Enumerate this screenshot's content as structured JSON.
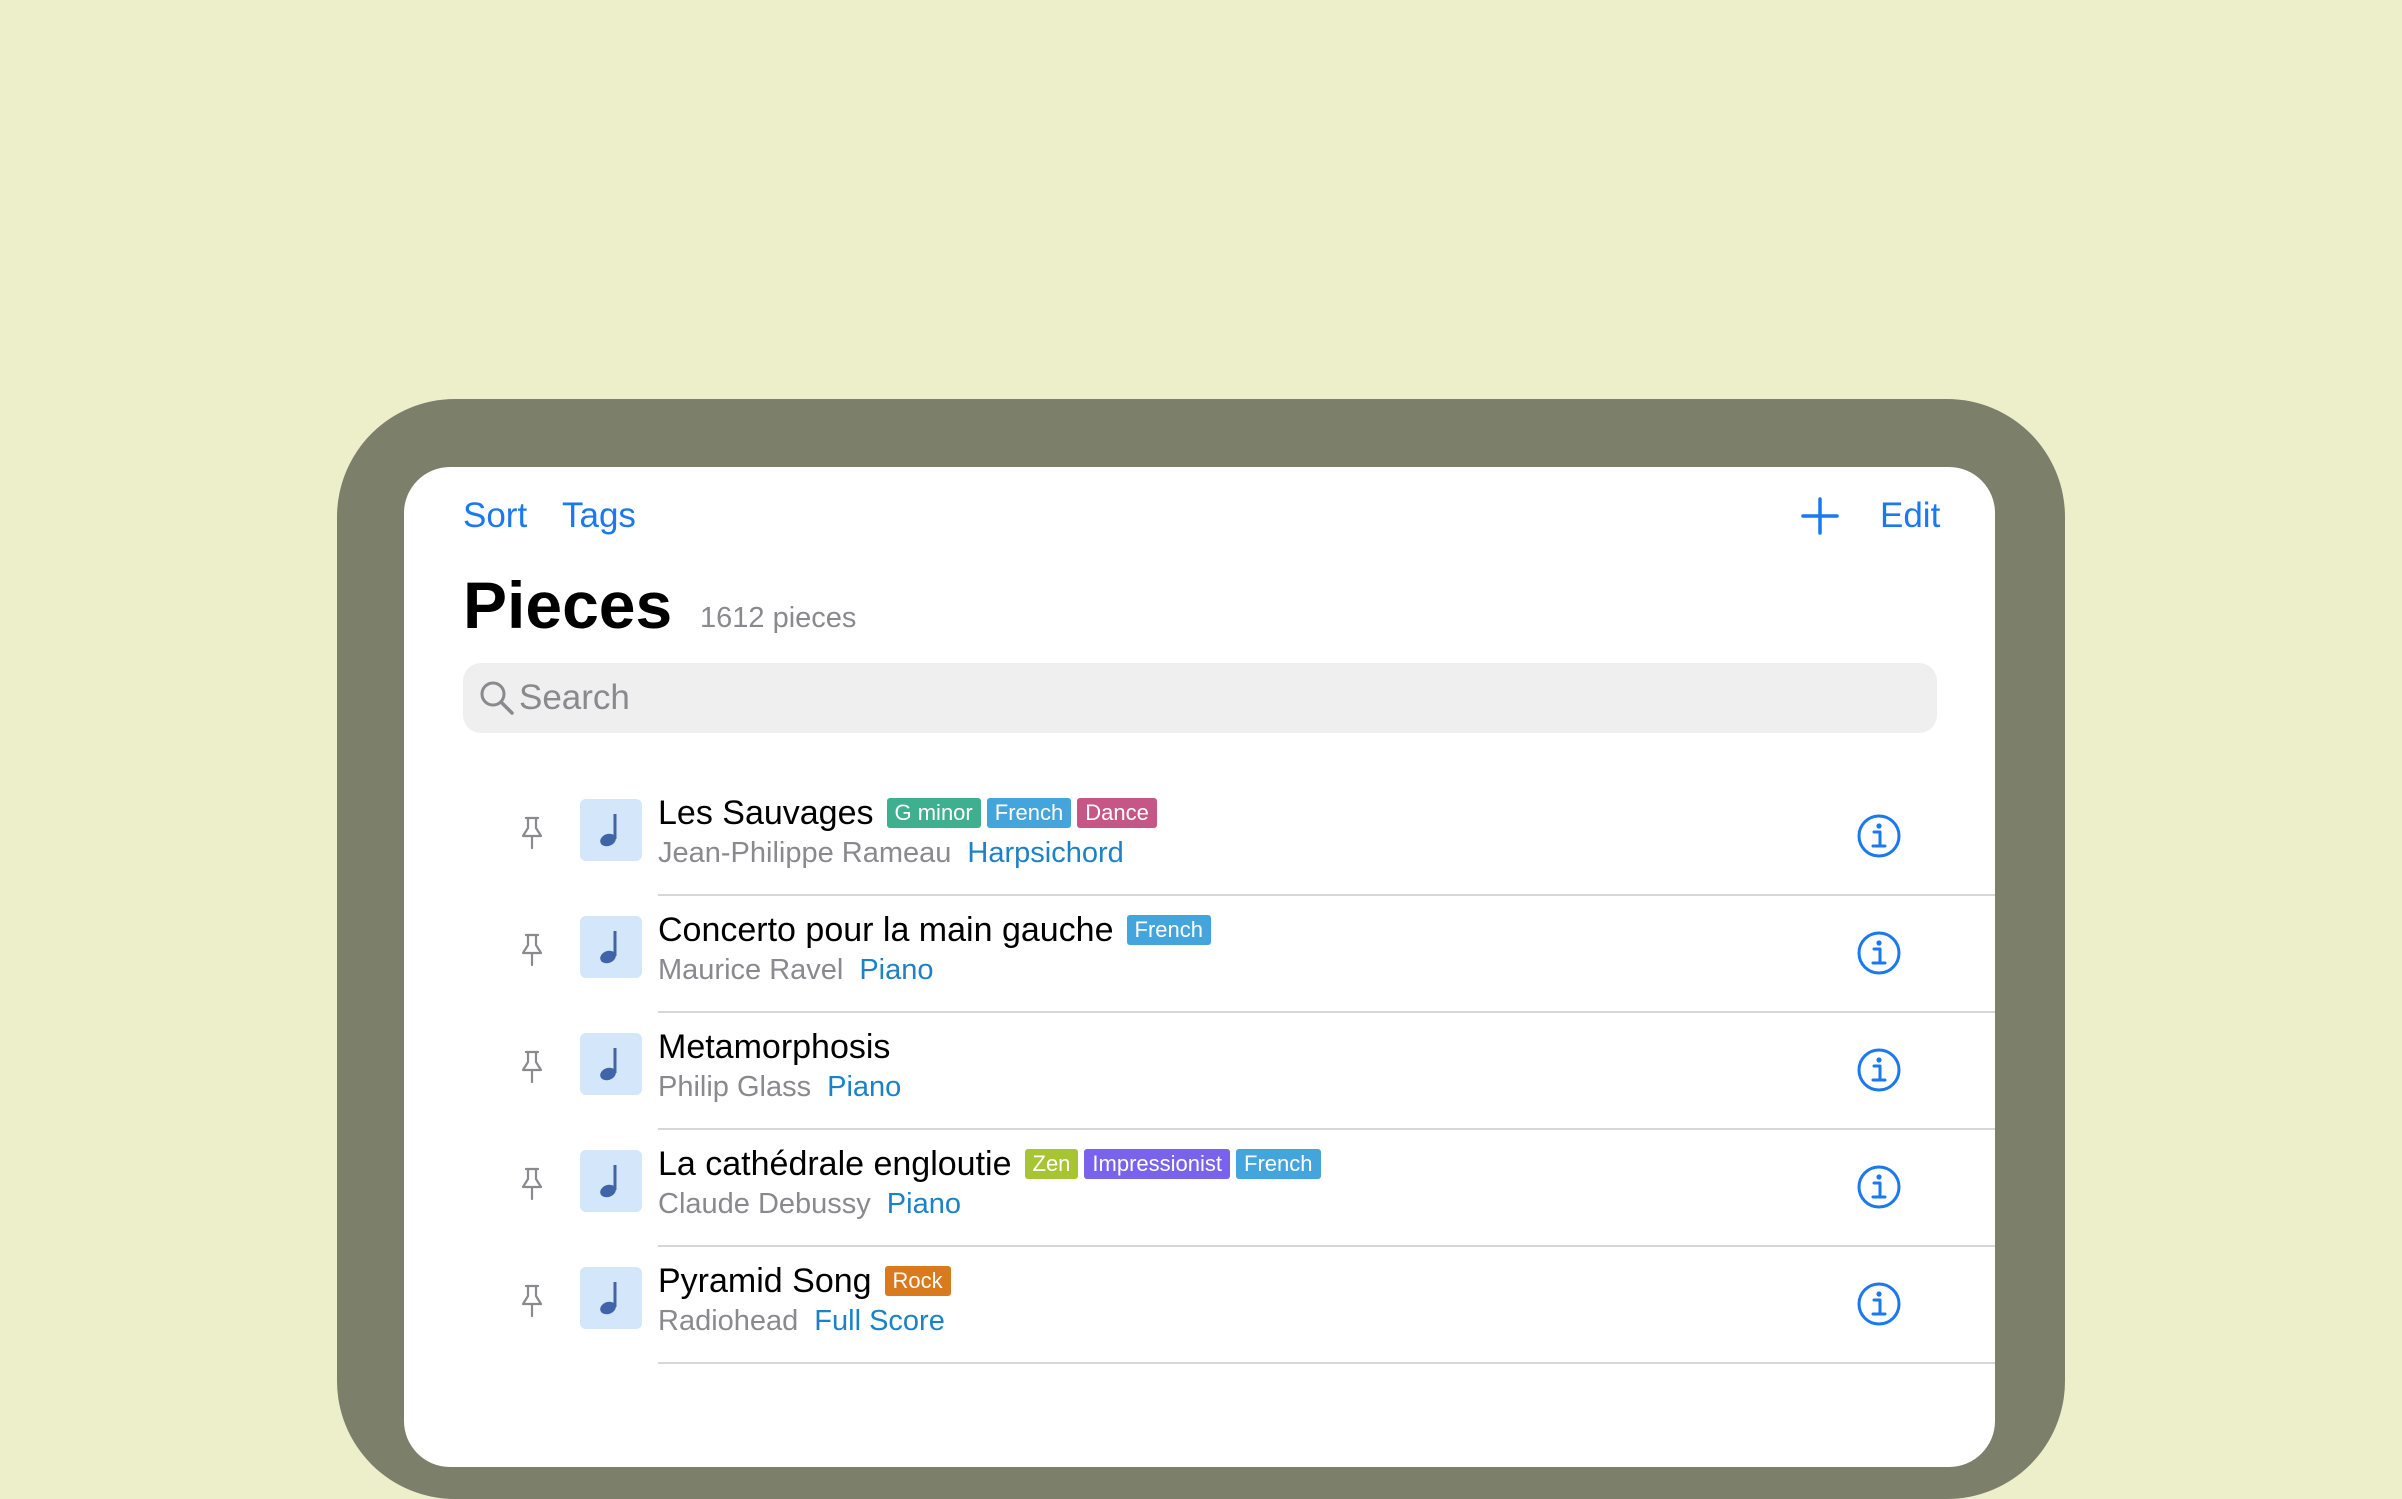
{
  "nav": {
    "sort": "Sort",
    "tags": "Tags",
    "edit": "Edit",
    "add_icon": "plus-icon"
  },
  "header": {
    "title": "Pieces",
    "count": "1612 pieces"
  },
  "search": {
    "placeholder": "Search",
    "icon": "magnifying-glass-icon"
  },
  "colors": {
    "accent": "#1A78F0",
    "background": "#ECEFCA",
    "frame": "#7C7F6A",
    "instrument": "#1C82C7"
  },
  "pieces": [
    {
      "title": "Les Sauvages",
      "tags": [
        {
          "label": "G minor",
          "color": "#3FB08F"
        },
        {
          "label": "French",
          "color": "#43A5DC"
        },
        {
          "label": "Dance",
          "color": "#C65685"
        }
      ],
      "composer": "Jean-Philippe Rameau",
      "instrument": "Harpsichord"
    },
    {
      "title": "Concerto pour la main gauche",
      "tags": [
        {
          "label": "French",
          "color": "#43A5DC"
        }
      ],
      "composer": "Maurice Ravel",
      "instrument": "Piano"
    },
    {
      "title": "Metamorphosis",
      "tags": [],
      "composer": "Philip Glass",
      "instrument": "Piano"
    },
    {
      "title": "La cathédrale engloutie",
      "tags": [
        {
          "label": "Zen",
          "color": "#A7C532"
        },
        {
          "label": "Impressionist",
          "color": "#7A63EC"
        },
        {
          "label": "French",
          "color": "#43A5DC"
        }
      ],
      "composer": "Claude Debussy",
      "instrument": "Piano"
    },
    {
      "title": "Pyramid Song",
      "tags": [
        {
          "label": "Rock",
          "color": "#D97A1E"
        }
      ],
      "composer": "Radiohead",
      "instrument": "Full Score"
    }
  ]
}
